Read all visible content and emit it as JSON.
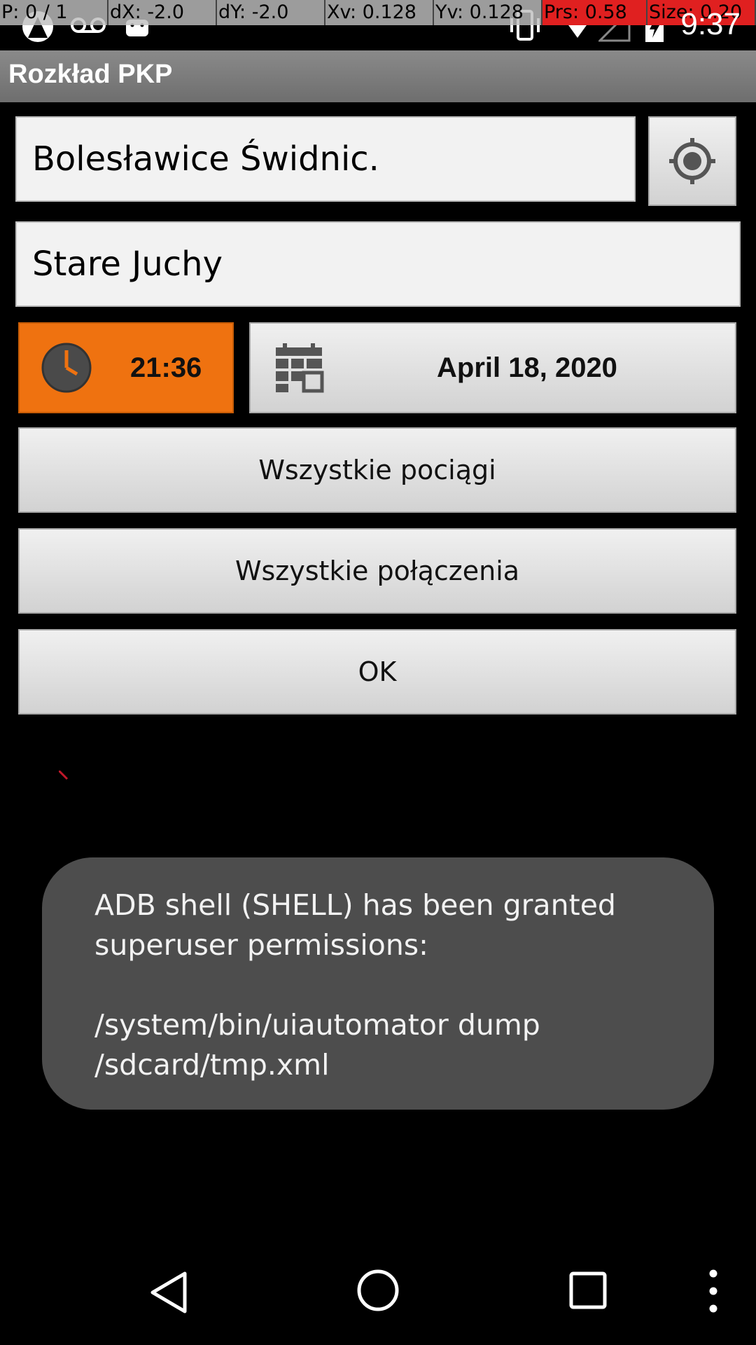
{
  "debug_overlay": {
    "p": "P: 0 / 1",
    "dx": "dX: -2.0",
    "dy": "dY: -2.0",
    "xv": "Xv: 0.128",
    "yv": "Yv: 0.128",
    "prs": "Prs: 0.58",
    "size": "Size: 0.20"
  },
  "status_bar": {
    "time": "9:37",
    "icons": [
      "app-notification-icon",
      "voicemail-icon",
      "android-icon",
      "vibrate-icon",
      "wifi-icon",
      "signal-icon",
      "battery-charging-icon"
    ]
  },
  "action_bar": {
    "title": "Rozkład PKP"
  },
  "form": {
    "from_station": "Bolesławice Świdnic.",
    "to_station": "Stare Juchy",
    "time": "21:36",
    "date": "April 18, 2020",
    "all_trains_label": "Wszystkie pociągi",
    "all_connections_label": "Wszystkie połączenia",
    "ok_label": "OK"
  },
  "toast": {
    "line1": "ADB shell (SHELL) has been granted superuser permissions:",
    "line2": "/system/bin/uiautomator dump /sdcard/tmp.xml"
  },
  "colors": {
    "accent_orange": "#ef7210",
    "action_bar": "#7a7a7a",
    "toast_bg": "#4d4d4d"
  }
}
